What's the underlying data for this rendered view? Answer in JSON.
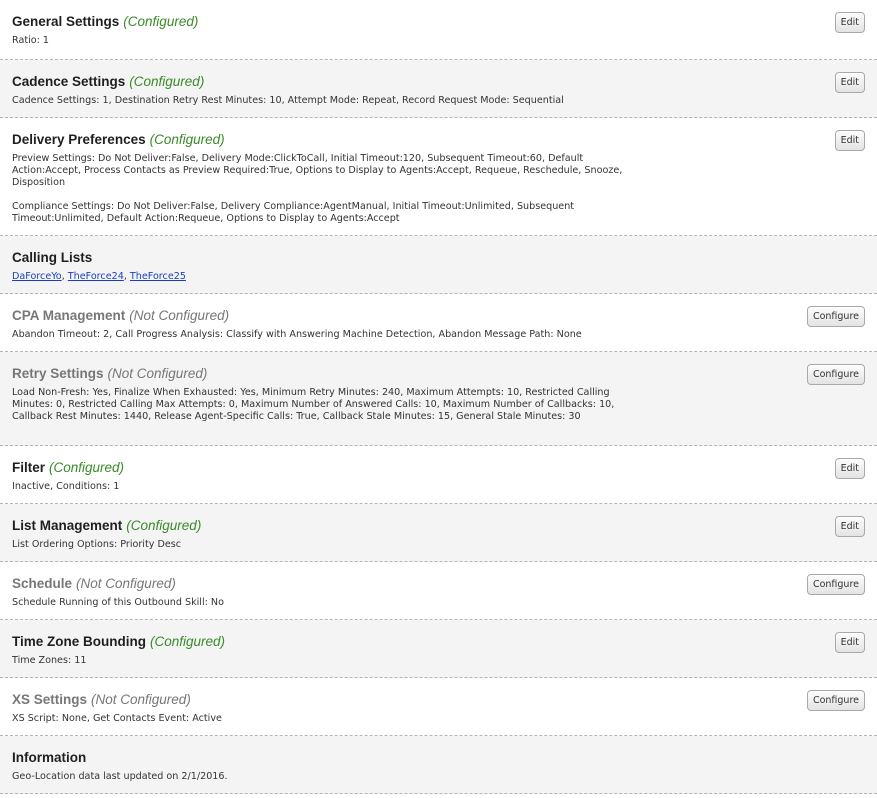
{
  "sections": {
    "general": {
      "title": "General Settings",
      "status": "(Configured)",
      "details": [
        "Ratio: 1"
      ],
      "action_label": "Edit"
    },
    "cadence": {
      "title": "Cadence Settings",
      "status": "(Configured)",
      "details": [
        "Cadence Settings: 1, Destination Retry Rest Minutes: 10, Attempt Mode: Repeat, Record Request Mode: Sequential"
      ],
      "action_label": "Edit"
    },
    "delivery": {
      "title": "Delivery Preferences",
      "status": "(Configured)",
      "details": [
        "Preview Settings: Do Not Deliver:False, Delivery Mode:ClickToCall, Initial Timeout:120, Subsequent Timeout:60, Default Action:Accept, Process Contacts as Preview Required:True, Options to Display to Agents:Accept, Requeue, Reschedule, Snooze, Disposition",
        "Compliance Settings: Do Not Deliver:False, Delivery Compliance:AgentManual, Initial Timeout:Unlimited, Subsequent Timeout:Unlimited, Default Action:Requeue, Options to Display to Agents:Accept"
      ],
      "action_label": "Edit"
    },
    "calling_lists": {
      "title": "Calling Lists",
      "links": [
        "DaForceYo",
        "TheForce24",
        "TheForce25"
      ],
      "separator": ", "
    },
    "cpa": {
      "title": "CPA Management",
      "status": "(Not Configured)",
      "details": [
        "Abandon Timeout: 2, Call Progress Analysis: Classify with Answering Machine Detection, Abandon Message Path: None"
      ],
      "action_label": "Configure"
    },
    "retry": {
      "title": "Retry Settings",
      "status": "(Not Configured)",
      "details": [
        "Load Non-Fresh: Yes, Finalize When Exhausted: Yes, Minimum Retry Minutes: 240, Maximum Attempts: 10, Restricted Calling Minutes: 0, Restricted Calling Max Attempts: 0, Maximum Number of Answered Calls: 10, Maximum Number of Callbacks: 10, Callback Rest Minutes: 1440, Release Agent-Specific Calls: True, Callback Stale Minutes: 15, General Stale Minutes: 30"
      ],
      "action_label": "Configure"
    },
    "filter": {
      "title": "Filter",
      "status": "(Configured)",
      "details": [
        "Inactive, Conditions: 1"
      ],
      "action_label": "Edit"
    },
    "list_management": {
      "title": "List Management",
      "status": "(Configured)",
      "details": [
        "List Ordering Options: Priority Desc"
      ],
      "action_label": "Edit"
    },
    "schedule": {
      "title": "Schedule",
      "status": "(Not Configured)",
      "details": [
        "Schedule Running of this Outbound Skill: No"
      ],
      "action_label": "Configure"
    },
    "time_zone": {
      "title": "Time Zone Bounding",
      "status": "(Configured)",
      "details": [
        "Time Zones: 11"
      ],
      "action_label": "Edit"
    },
    "xs": {
      "title": "XS Settings",
      "status": "(Not Configured)",
      "details": [
        "XS Script: None, Get Contacts Event: Active"
      ],
      "action_label": "Configure"
    },
    "information": {
      "title": "Information",
      "details": [
        "Geo-Location data last updated on 2/1/2016."
      ]
    }
  },
  "colors": {
    "configured_status": "#3a8a2a",
    "not_configured": "#777777",
    "link": "#1a3fc0",
    "alt_row_bg": "#f4f4f4"
  }
}
